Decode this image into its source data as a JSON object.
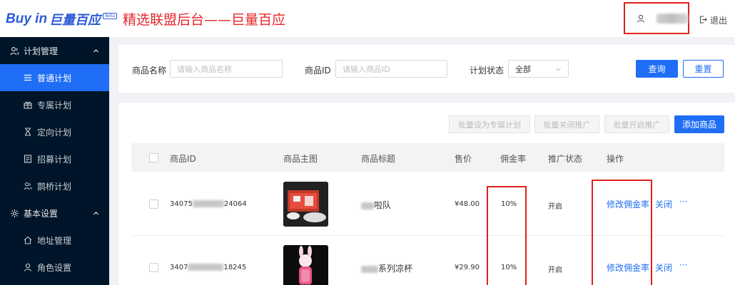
{
  "header": {
    "logo_en": "Buy in",
    "logo_cn": "巨量百应",
    "logo_badge": "Beta",
    "title": "精选联盟后台——巨量百应",
    "logout_label": "退出"
  },
  "sidebar": {
    "groups": [
      {
        "label": "计划管理",
        "items": [
          "普通计划",
          "专属计划",
          "定向计划",
          "招募计划",
          "鹊桥计划"
        ]
      },
      {
        "label": "基本设置",
        "items": [
          "地址管理",
          "角色设置"
        ]
      }
    ]
  },
  "filter": {
    "product_name_label": "商品名称",
    "product_name_placeholder": "请输入商品名称",
    "product_id_label": "商品ID",
    "product_id_placeholder": "请输入商品ID",
    "status_label": "计划状态",
    "status_value": "全部",
    "query_label": "查询",
    "reset_label": "重置"
  },
  "toolbar": {
    "batch_exclusive": "批量设为专属计划",
    "batch_close": "批量关闭推广",
    "batch_open": "批量开启推广",
    "add_product": "添加商品"
  },
  "table": {
    "headers": [
      "商品ID",
      "商品主图",
      "商品标题",
      "售价",
      "佣金率",
      "推广状态",
      "操作"
    ],
    "rows": [
      {
        "id_prefix": "34075",
        "id_suffix": "24064",
        "title_prefix": "",
        "title_suffix": "啦队",
        "price": "¥48.00",
        "commission": "10%",
        "status": "开启",
        "action_edit": "修改佣金率",
        "action_close": "关闭",
        "action_more": "···"
      },
      {
        "id_prefix": "3407",
        "id_suffix": "18245",
        "title_prefix": "",
        "title_suffix": "系列凉杯",
        "price": "¥29.90",
        "commission": "10%",
        "status": "开启",
        "action_edit": "修改佣金率",
        "action_close": "关闭",
        "action_more": "···"
      }
    ]
  },
  "colors": {
    "primary": "#1f6ef5",
    "sidebar_bg": "#001529",
    "highlight_red": "#e0201c"
  }
}
